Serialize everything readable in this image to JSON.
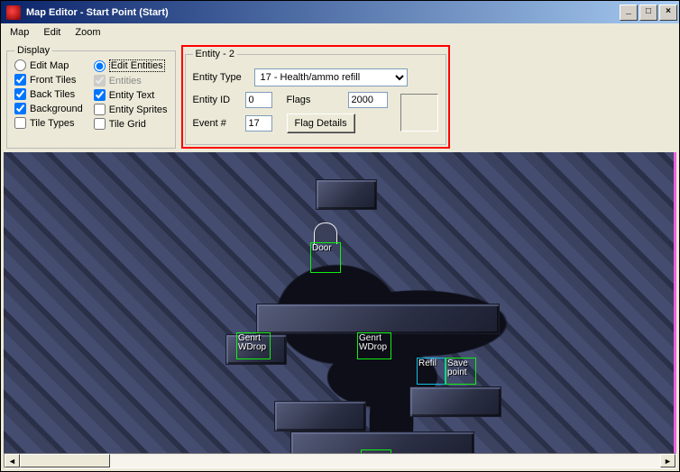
{
  "window": {
    "title": "Map Editor - Start Point (Start)"
  },
  "window_controls": {
    "min": "_",
    "max": "□",
    "close": "×"
  },
  "menu": {
    "map": "Map",
    "edit": "Edit",
    "zoom": "Zoom"
  },
  "display": {
    "legend": "Display",
    "edit_map": "Edit Map",
    "front_tiles": "Front Tiles",
    "back_tiles": "Back Tiles",
    "background": "Background",
    "tile_types": "Tile Types",
    "edit_entities": "Edit Entities",
    "entities": "Entities",
    "entity_text": "Entity Text",
    "entity_sprites": "Entity Sprites",
    "tile_grid": "Tile Grid",
    "checked": {
      "edit_map": false,
      "front_tiles": true,
      "back_tiles": true,
      "background": true,
      "tile_types": false,
      "edit_entities": true,
      "entities": true,
      "entity_text": true,
      "entity_sprites": false,
      "tile_grid": false
    }
  },
  "entity_panel": {
    "legend": "Entity - 2",
    "type_label": "Entity Type",
    "type_value": "17 - Health/ammo refill",
    "id_label": "Entity ID",
    "id_value": "0",
    "flags_label": "Flags",
    "flags_value": "2000",
    "event_label": "Event #",
    "event_value": "17",
    "flag_details_label": "Flag Details"
  },
  "map_entities": {
    "door": "Door",
    "genrt_wdrop_1": "Genrt\nWDrop",
    "genrt_wdrop_2": "Genrt\nWDrop",
    "refil": "Refil",
    "save_point": "Save\npoint"
  },
  "colors": {
    "highlight_border": "#ff0000",
    "entity_green": "#10f010",
    "entity_cyan": "#10c0e0"
  }
}
